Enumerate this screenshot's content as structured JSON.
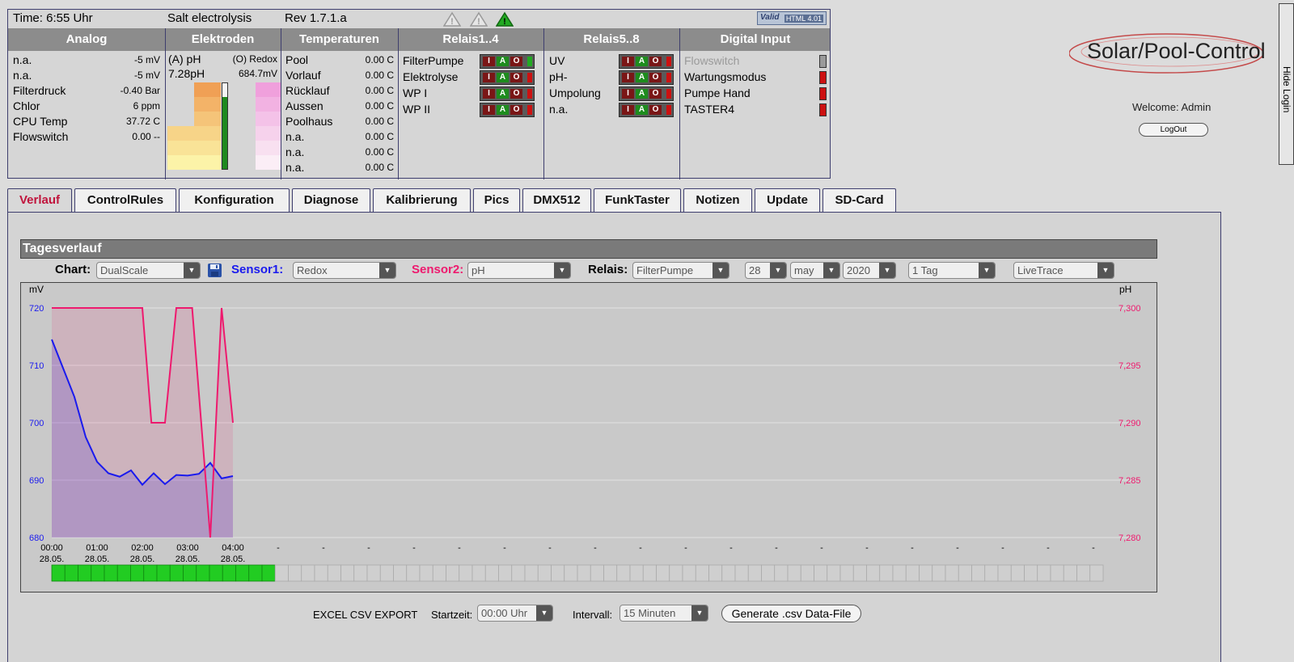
{
  "status": {
    "time": "Time: 6:55 Uhr",
    "mode": "Salt electrolysis",
    "rev": "Rev 1.7.1.a",
    "validator_v": "Valid",
    "validator_html": "HTML 4.01"
  },
  "headers": [
    "Analog",
    "Elektroden",
    "Temperaturen",
    "Relais1..4",
    "Relais5..8",
    "Digital Input"
  ],
  "analog": [
    {
      "label": "n.a.",
      "value": "-5 mV"
    },
    {
      "label": "n.a.",
      "value": "-5 mV"
    },
    {
      "label": "Filterdruck",
      "value": "-0.40 Bar"
    },
    {
      "label": "Chlor",
      "value": "6 ppm"
    },
    {
      "label": "CPU Temp",
      "value": "37.72 C"
    },
    {
      "label": "Flowswitch",
      "value": "0.00 --"
    }
  ],
  "elektroden": {
    "ph_label": "(A) pH",
    "ph_value": "7.28pH",
    "redox_label": "(O) Redox",
    "redox_value": "684.7mV"
  },
  "temperaturen": [
    {
      "label": "Pool",
      "value": "0.00 C"
    },
    {
      "label": "Vorlauf",
      "value": "0.00 C"
    },
    {
      "label": "Rücklauf",
      "value": "0.00 C"
    },
    {
      "label": "Aussen",
      "value": "0.00 C"
    },
    {
      "label": "Poolhaus",
      "value": "0.00 C"
    },
    {
      "label": "n.a.",
      "value": "0.00 C"
    },
    {
      "label": "n.a.",
      "value": "0.00 C"
    },
    {
      "label": "n.a.",
      "value": "0.00 C"
    }
  ],
  "iao": {
    "i": "I",
    "a": "A",
    "o": "O"
  },
  "relais1": [
    {
      "label": "FilterPumpe",
      "state_color": "#22aa22"
    },
    {
      "label": "Elektrolyse",
      "state_color": "#cc1111"
    },
    {
      "label": "WP I",
      "state_color": "#cc1111"
    },
    {
      "label": "WP II",
      "state_color": "#cc1111"
    }
  ],
  "relais2": [
    {
      "label": "UV",
      "state_color": "#cc1111"
    },
    {
      "label": "pH-",
      "state_color": "#cc1111"
    },
    {
      "label": "Umpolung",
      "state_color": "#cc1111"
    },
    {
      "label": "n.a.",
      "state_color": "#cc1111"
    }
  ],
  "digital": [
    {
      "label": "Flowswitch",
      "led": "#9a9a9a",
      "disabled": true
    },
    {
      "label": "Wartungsmodus",
      "led": "#cc1111"
    },
    {
      "label": "Pumpe Hand",
      "led": "#cc1111"
    },
    {
      "label": "TASTER4",
      "led": "#cc1111"
    }
  ],
  "logo": "Solar/Pool-Control",
  "welcome": "Welcome: Admin",
  "logout": "LogOut",
  "hide_login": "Hide Login",
  "tabs": [
    "Verlauf",
    "ControlRules",
    "Konfiguration",
    "Diagnose",
    "Kalibrierung",
    "Pics",
    "DMX512",
    "FunkTaster",
    "Notizen",
    "Update",
    "SD-Card"
  ],
  "section_title": "Tagesverlauf",
  "controls": {
    "chart_label": "Chart:",
    "chart_value": "DualScale",
    "sensor1_label": "Sensor1:",
    "sensor1_value": "Redox",
    "sensor2_label": "Sensor2:",
    "sensor2_value": "pH",
    "relais_label": "Relais:",
    "relais_value": "FilterPumpe",
    "day": "28",
    "month": "may",
    "year": "2020",
    "range": "1 Tag",
    "trace": "LiveTrace"
  },
  "csv": {
    "title": "EXCEL CSV EXPORT",
    "start_label": "Startzeit:",
    "start_value": "00:00 Uhr",
    "interval_label": "Intervall:",
    "interval_value": "15 Minuten",
    "generate": "Generate .csv Data-File"
  },
  "colors": {
    "sensor1": "#1a1aee",
    "sensor2": "#ee1a6e",
    "active_tab": "#c0143c",
    "relay_on": "#22cc22"
  },
  "chart_data": {
    "type": "line",
    "left_unit": "mV",
    "right_unit": "pH",
    "y1lim": [
      680,
      720
    ],
    "y1ticks": [
      "720",
      "710",
      "700",
      "690",
      "680"
    ],
    "y2lim": [
      7.28,
      7.3
    ],
    "y2ticks": [
      "7,300",
      "7,295",
      "7,290",
      "7,285",
      "7,280"
    ],
    "xlim": [
      0,
      24
    ],
    "xticks": [
      {
        "h": 0,
        "time": "00:00",
        "date": "28.05."
      },
      {
        "h": 1,
        "time": "01:00",
        "date": "28.05."
      },
      {
        "h": 2,
        "time": "02:00",
        "date": "28.05."
      },
      {
        "h": 3,
        "time": "03:00",
        "date": "28.05."
      },
      {
        "h": 4,
        "time": "04:00",
        "date": "28.05."
      }
    ],
    "xtick_dashes": [
      "-",
      "-",
      "-",
      "-",
      "-",
      "-",
      "-",
      "-",
      "-",
      "-",
      "-",
      "-",
      "-",
      "-",
      "-",
      "-",
      "-",
      "-",
      "-"
    ],
    "series": [
      {
        "axis": "left",
        "color": "#1a1aee",
        "x": [
          0,
          0.25,
          0.5,
          0.75,
          1,
          1.25,
          1.5,
          1.75,
          2,
          2.25,
          2.5,
          2.75,
          3,
          3.25,
          3.5,
          3.75,
          4
        ],
        "y": [
          714.5,
          709.5,
          704.5,
          697.5,
          693.2,
          691.2,
          690.6,
          691.7,
          689.2,
          691.2,
          689.3,
          690.9,
          690.8,
          691.1,
          693.0,
          690.3,
          690.7
        ]
      },
      {
        "axis": "right",
        "color": "#ee1a6e",
        "x": [
          0,
          0.5,
          1,
          1.5,
          2,
          2.2,
          2.5,
          2.75,
          2.9,
          3.1,
          3.5,
          3.75,
          4
        ],
        "y": [
          7.3,
          7.3,
          7.3,
          7.3,
          7.3,
          7.29,
          7.29,
          7.3,
          7.3,
          7.3,
          7.28,
          7.3,
          7.29
        ]
      }
    ],
    "relay_blocks_total": 80,
    "relay_blocks_on": 17
  }
}
